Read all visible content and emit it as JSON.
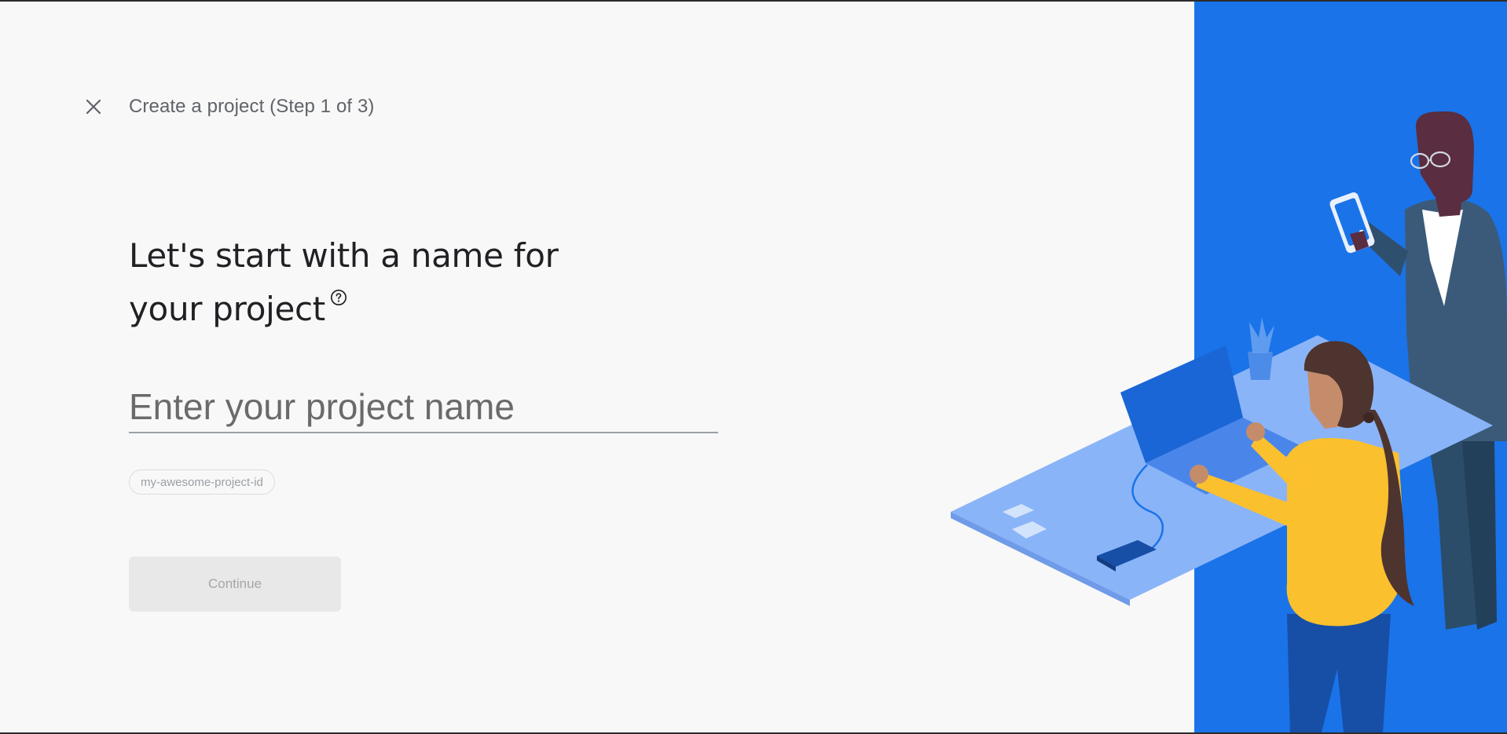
{
  "header": {
    "close_icon": "close-icon",
    "title": "Create a project (Step 1 of 3)"
  },
  "main": {
    "headline_line1": "Let's start with a name for",
    "headline_line2": "your project",
    "help_icon": "help-circle-icon",
    "project_name_input": {
      "value": "",
      "placeholder": "Enter your project name"
    },
    "project_id_chip": "my-awesome-project-id",
    "continue_label": "Continue"
  },
  "colors": {
    "panel_blue": "#1a73e8",
    "background": "#f8f8f8",
    "text_primary": "#202124",
    "text_secondary": "#5f6368"
  }
}
